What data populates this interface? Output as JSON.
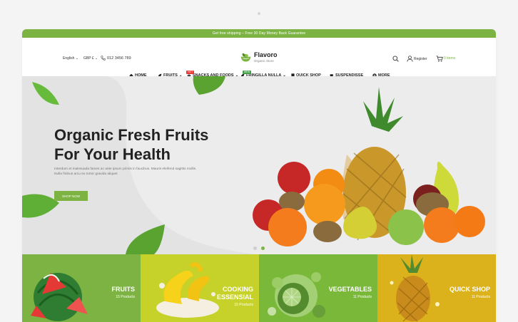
{
  "topbar": {
    "text": "Get free shipping – Free 30 Day Money Back Guarantee"
  },
  "header": {
    "language": "English",
    "currency": "GBP £",
    "phone": "012 3456 789",
    "logo_name": "Flavoro",
    "logo_tagline": "Organic Store",
    "register": "Register",
    "cart_items": "0 items"
  },
  "nav": {
    "home": "HOME",
    "fruits": "FRUITS",
    "snacks": "SNACKS AND FOODS",
    "fringilla": "FRINGILLA NULLA",
    "quick_shop": "QUICK SHOP",
    "suspendisse": "SUSPENDISSE",
    "more": "MORE",
    "badge_hot": "HOT",
    "badge_new": "NEW"
  },
  "hero": {
    "title_line1": "Organic Fresh Fruits",
    "title_line2": "For Your Health",
    "text_line1": "Interdum et malesuada fames ac ante ipsum primis in faucibus. Mauris eleifend sagittis mollis.",
    "text_line2": "Nulla finibus arcu eu tortor gravida aliquet",
    "button": "SHOP NOW",
    "active_slide": 2
  },
  "categories": [
    {
      "name_line1": "FRUITS",
      "name_line2": "",
      "count": "15 Products"
    },
    {
      "name_line1": "COOKING",
      "name_line2": "ESSENSIAL",
      "count": "15 Products"
    },
    {
      "name_line1": "VEGETABLES",
      "name_line2": "",
      "count": "11 Products"
    },
    {
      "name_line1": "QUICK SHOP",
      "name_line2": "",
      "count": "11 Products"
    }
  ],
  "colors": {
    "accent": "#7cb342",
    "badge_hot": "#e53935",
    "badge_new": "#43a047",
    "text": "#222222"
  },
  "icons": [
    "search-icon",
    "user-icon",
    "cart-icon",
    "phone-icon",
    "home-icon",
    "leaf-icon",
    "book-icon",
    "grid-icon"
  ]
}
